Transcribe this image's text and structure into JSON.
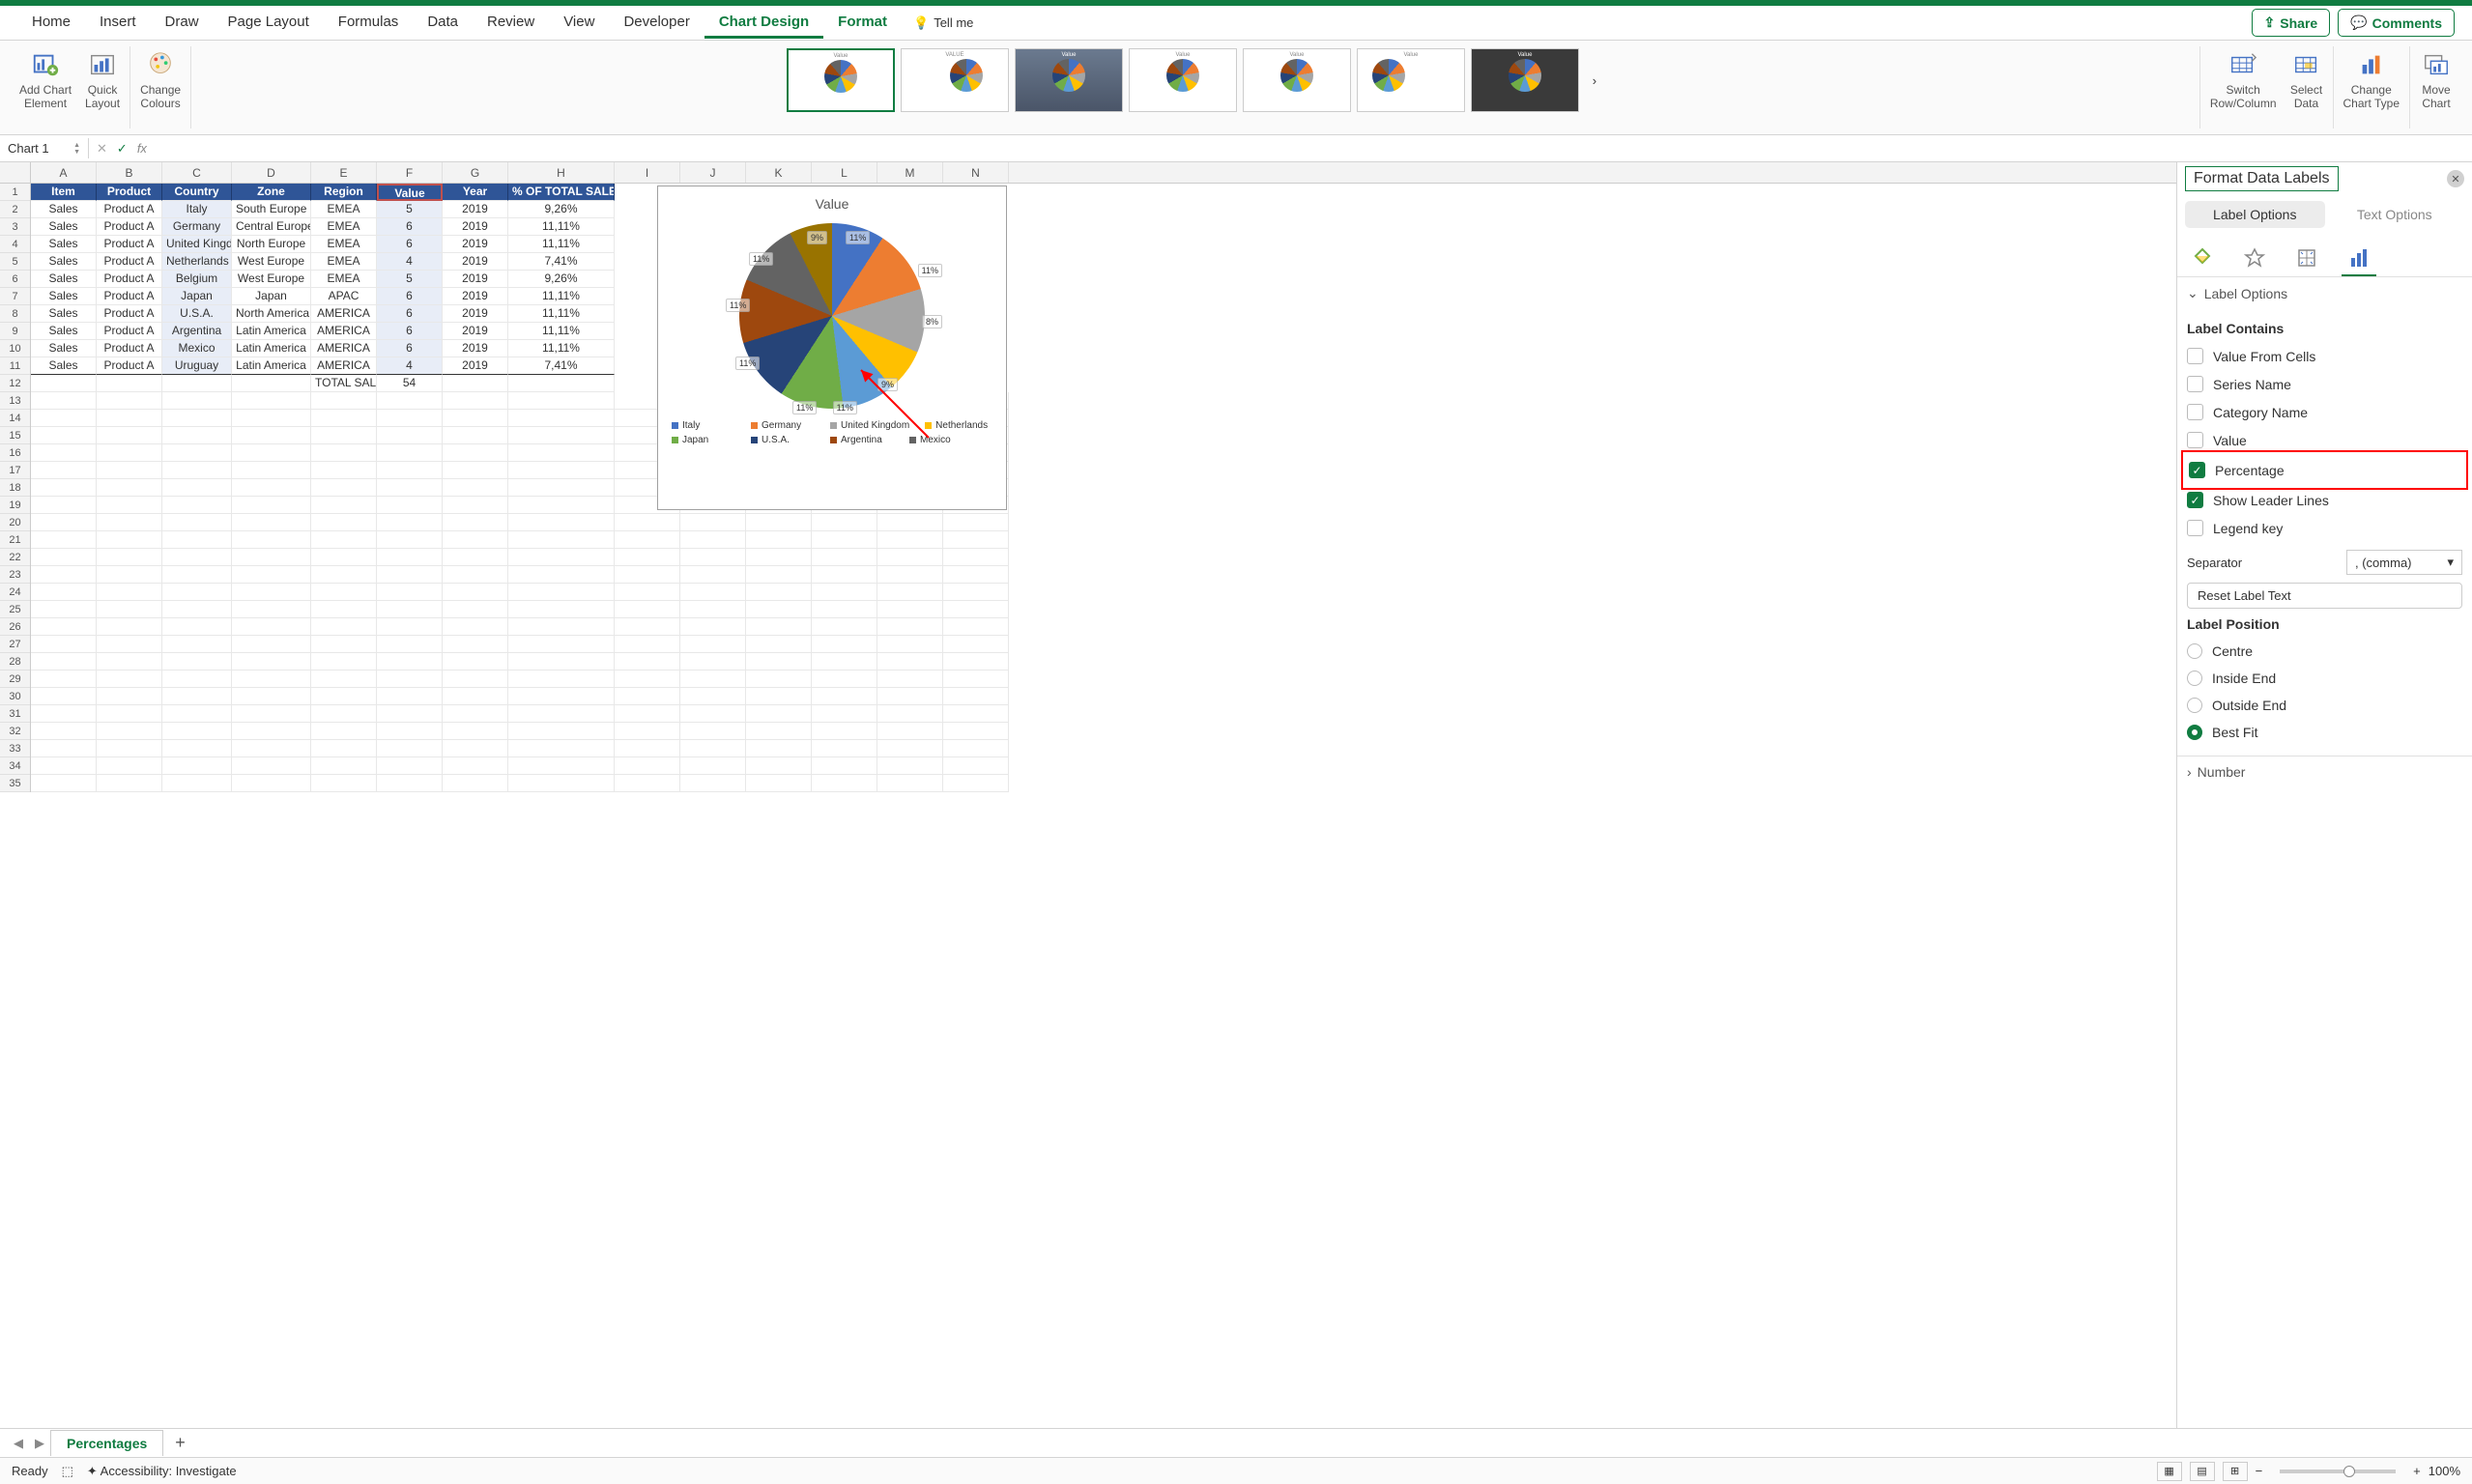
{
  "tabs": [
    "Home",
    "Insert",
    "Draw",
    "Page Layout",
    "Formulas",
    "Data",
    "Review",
    "View",
    "Developer",
    "Chart Design",
    "Format"
  ],
  "active_tab": "Chart Design",
  "tell_me": "Tell me",
  "share": "Share",
  "comments": "Comments",
  "ribbon": {
    "add_chart_element": "Add Chart\nElement",
    "quick_layout": "Quick\nLayout",
    "change_colours": "Change\nColours",
    "switch": "Switch\nRow/Column",
    "select_data": "Select\nData",
    "change_chart_type": "Change\nChart Type",
    "move_chart": "Move\nChart",
    "style_label": "Value"
  },
  "name_box": "Chart 1",
  "columns": [
    "A",
    "B",
    "C",
    "D",
    "E",
    "F",
    "G",
    "H",
    "I",
    "J",
    "K",
    "L",
    "M",
    "N"
  ],
  "table": {
    "headers": [
      "Item",
      "Product",
      "Country",
      "Zone",
      "Region",
      "Value",
      "Year",
      "% OF TOTAL SALES"
    ],
    "rows": [
      [
        "Sales",
        "Product A",
        "Italy",
        "South Europe",
        "EMEA",
        "5",
        "2019",
        "9,26%"
      ],
      [
        "Sales",
        "Product A",
        "Germany",
        "Central Europe",
        "EMEA",
        "6",
        "2019",
        "11,11%"
      ],
      [
        "Sales",
        "Product A",
        "United Kingdom",
        "North Europe",
        "EMEA",
        "6",
        "2019",
        "11,11%"
      ],
      [
        "Sales",
        "Product A",
        "Netherlands",
        "West Europe",
        "EMEA",
        "4",
        "2019",
        "7,41%"
      ],
      [
        "Sales",
        "Product A",
        "Belgium",
        "West Europe",
        "EMEA",
        "5",
        "2019",
        "9,26%"
      ],
      [
        "Sales",
        "Product A",
        "Japan",
        "Japan",
        "APAC",
        "6",
        "2019",
        "11,11%"
      ],
      [
        "Sales",
        "Product A",
        "U.S.A.",
        "North America",
        "AMERICA",
        "6",
        "2019",
        "11,11%"
      ],
      [
        "Sales",
        "Product A",
        "Argentina",
        "Latin America",
        "AMERICA",
        "6",
        "2019",
        "11,11%"
      ],
      [
        "Sales",
        "Product A",
        "Mexico",
        "Latin America",
        "AMERICA",
        "6",
        "2019",
        "11,11%"
      ],
      [
        "Sales",
        "Product A",
        "Uruguay",
        "Latin America",
        "AMERICA",
        "4",
        "2019",
        "7,41%"
      ]
    ],
    "total_label": "TOTAL SALES",
    "total_value": "54"
  },
  "chart": {
    "title": "Value",
    "labels": [
      "9%",
      "11%",
      "11%",
      "8%",
      "9%",
      "11%",
      "11%",
      "11%",
      "11%",
      "11%"
    ],
    "legend": [
      {
        "name": "Italy",
        "color": "#4472c4"
      },
      {
        "name": "Germany",
        "color": "#ed7d31"
      },
      {
        "name": "United Kingdom",
        "color": "#a5a5a5"
      },
      {
        "name": "Netherlands",
        "color": "#ffc000"
      },
      {
        "name": "Japan",
        "color": "#70ad47"
      },
      {
        "name": "U.S.A.",
        "color": "#264478"
      },
      {
        "name": "Argentina",
        "color": "#9e480e"
      },
      {
        "name": "Mexico",
        "color": "#636363"
      }
    ]
  },
  "chart_data": {
    "type": "pie",
    "title": "Value",
    "categories": [
      "Italy",
      "Germany",
      "United Kingdom",
      "Netherlands",
      "Belgium",
      "Japan",
      "U.S.A.",
      "Argentina",
      "Mexico",
      "Uruguay"
    ],
    "values": [
      5,
      6,
      6,
      4,
      5,
      6,
      6,
      6,
      6,
      4
    ],
    "percentages": [
      "9%",
      "11%",
      "11%",
      "8%",
      "9%",
      "11%",
      "11%",
      "11%",
      "11%",
      "11%"
    ],
    "legend_position": "bottom"
  },
  "panel": {
    "title": "Format Data Labels",
    "label_options": "Label Options",
    "text_options": "Text Options",
    "section_label_options": "Label Options",
    "label_contains": "Label Contains",
    "checks": {
      "value_from_cells": "Value From Cells",
      "series_name": "Series Name",
      "category_name": "Category Name",
      "value": "Value",
      "percentage": "Percentage",
      "leader": "Show Leader Lines",
      "legend_key": "Legend key"
    },
    "separator": "Separator",
    "separator_value": ", (comma)",
    "reset": "Reset Label Text",
    "label_position": "Label Position",
    "positions": {
      "centre": "Centre",
      "inside": "Inside End",
      "outside": "Outside End",
      "best": "Best Fit"
    },
    "number": "Number"
  },
  "sheet_tab": "Percentages",
  "status": {
    "ready": "Ready",
    "accessibility": "Accessibility: Investigate",
    "zoom": "100%"
  }
}
